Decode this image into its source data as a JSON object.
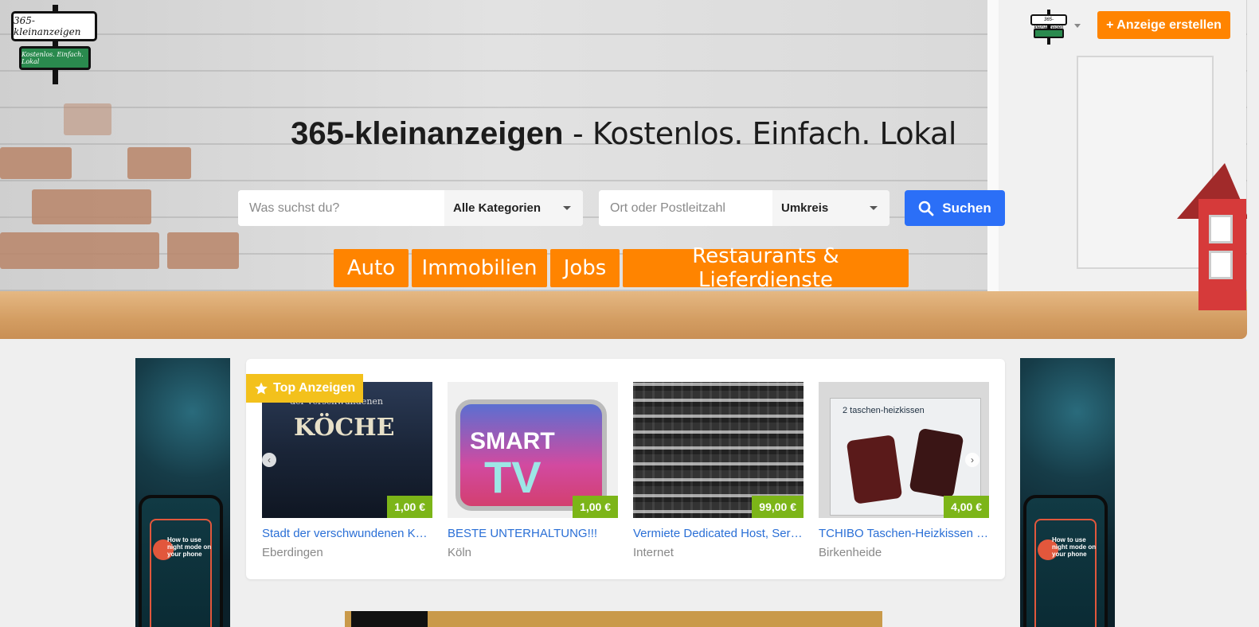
{
  "logo": {
    "line1": "365-kleinanzeigen",
    "line2": "Kostenlos. Einfach. Lokal"
  },
  "header": {
    "create_button": "+ Anzeige erstellen",
    "avatar_text": "365-kleinanzeigen"
  },
  "hero": {
    "title_bold": "365-kleinanzeigen",
    "title_rest": " - Kostenlos. Einfach. Lokal"
  },
  "search": {
    "query_placeholder": "Was suchst du?",
    "category_value": "Alle Kategorien",
    "location_placeholder": "Ort oder Postleitzahl",
    "radius_value": "Umkreis",
    "submit_label": "Suchen"
  },
  "categories": [
    "Auto",
    "Immobilien",
    "Jobs",
    "Restaurants & Lieferdienste"
  ],
  "top_ads": {
    "badge": "Top Anzeigen",
    "items": [
      {
        "title": "Stadt der verschwundenen Köche",
        "location": "Eberdingen",
        "price": "1,00 €",
        "image_text": "der verschwundenen",
        "image_text2": "KÖCHE"
      },
      {
        "title": "BESTE UNTERHALTUNG!!!",
        "location": "Köln",
        "price": "1,00 €",
        "image_text": "SMART",
        "image_text2": "TV"
      },
      {
        "title": "Vermiete Dedicated Host, Server...",
        "location": "Internet",
        "price": "99,00 €"
      },
      {
        "title": "TCHIBO Taschen-Heizkissen - po...",
        "location": "Birkenheide",
        "price": "4,00 €",
        "image_text": "2 taschen-heizkissen"
      }
    ]
  },
  "side_ad": {
    "text": "How to use night mode on your phone"
  },
  "colors": {
    "accent": "#ff8400",
    "primary": "#2b6ff7",
    "price": "#7cb518",
    "badge": "#f3c11c",
    "link": "#2a6fd6"
  },
  "icons": {
    "search": "search-icon",
    "star": "star-icon",
    "prev": "chevron-left-icon",
    "next": "chevron-right-icon"
  }
}
